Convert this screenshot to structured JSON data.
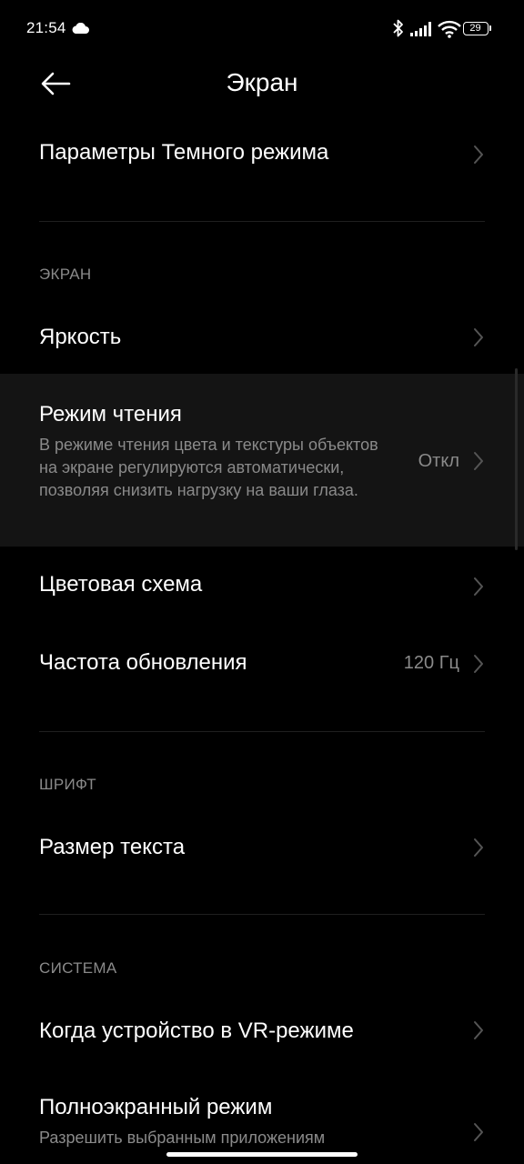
{
  "status": {
    "time": "21:54",
    "battery": "29"
  },
  "header": {
    "title": "Экран"
  },
  "items": {
    "dark_mode": {
      "title": "Параметры Темного режима"
    },
    "brightness": {
      "title": "Яркость"
    },
    "reading_mode": {
      "title": "Режим чтения",
      "subtitle": "В режиме чтения цвета и текстуры объектов на экране регулируются автоматически, позволяя снизить нагрузку на ваши глаза.",
      "value": "Откл"
    },
    "color_scheme": {
      "title": "Цветовая схема"
    },
    "refresh_rate": {
      "title": "Частота обновления",
      "value": "120 Гц"
    },
    "text_size": {
      "title": "Размер текста"
    },
    "vr_mode": {
      "title": "Когда устройство в VR-режиме"
    },
    "fullscreen": {
      "title": "Полноэкранный режим",
      "subtitle": "Разрешить выбранным приложениям"
    }
  },
  "sections": {
    "screen": "ЭКРАН",
    "font": "ШРИФТ",
    "system": "СИСТЕМА"
  },
  "colors": {
    "background": "#000000",
    "highlight": "#141414",
    "secondary_text": "#8a8a8a"
  }
}
